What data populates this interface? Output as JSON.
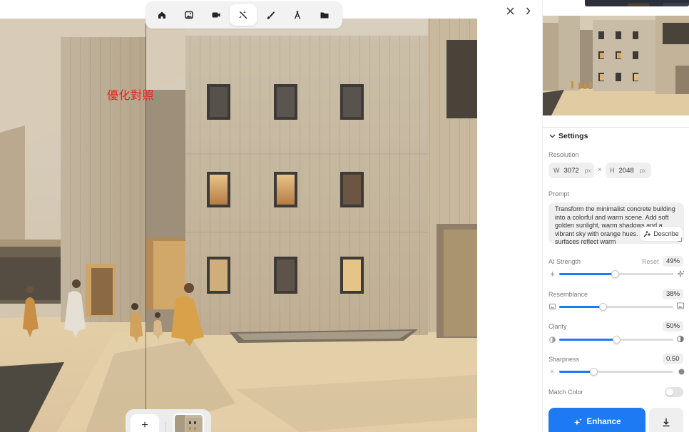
{
  "canvas": {
    "compare_label": "優化對照"
  },
  "toolbar": {
    "tools": [
      {
        "icon": "home-icon"
      },
      {
        "icon": "image-icon"
      },
      {
        "icon": "video-camera-icon"
      },
      {
        "icon": "magic-wand-icon",
        "active": true
      },
      {
        "icon": "paint-brush-icon"
      },
      {
        "icon": "drafting-compass-icon"
      },
      {
        "icon": "folder-icon"
      }
    ]
  },
  "window": {
    "close_symbol": "✕",
    "next_symbol": "›"
  },
  "bottom_strip": {
    "add_symbol": "+"
  },
  "settings": {
    "header": "Settings",
    "resolution": {
      "label": "Resolution",
      "w_tag": "W",
      "w_value": "3072",
      "h_tag": "H",
      "h_value": "2048",
      "unit": "px",
      "times": "×"
    },
    "prompt": {
      "label": "Prompt",
      "text": "Transform the minimalist concrete building into a colorful and warm scene. Add soft golden sunlight, warm shadows and a vibrant sky with orange hues. The concrete surfaces reflect warm",
      "describe_label": "Describe"
    },
    "sliders": {
      "ai_strength": {
        "label": "AI Strength",
        "reset_label": "Reset",
        "value_text": "49%",
        "value": 0.49
      },
      "resemblance": {
        "label": "Resemblance",
        "value_text": "38%",
        "value": 0.38
      },
      "clarity": {
        "label": "Clarity",
        "value_text": "50%",
        "value": 0.5
      },
      "sharpness": {
        "label": "Sharpness",
        "value_text": "0.50",
        "value": 0.3
      }
    },
    "match_color": {
      "label": "Match Color",
      "enabled": false
    }
  },
  "actions": {
    "enhance_label": "Enhance"
  },
  "colors": {
    "accent": "#1d7af3",
    "compare_label": "#e8231f"
  }
}
